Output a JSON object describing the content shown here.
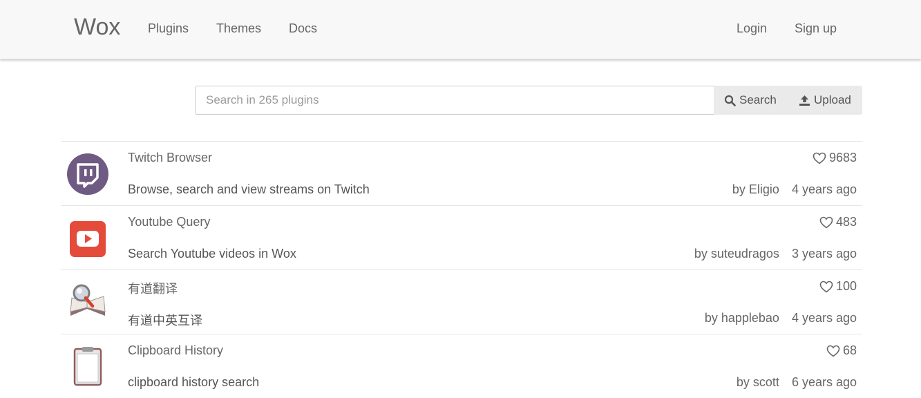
{
  "nav": {
    "brand": "Wox",
    "links": [
      "Plugins",
      "Themes",
      "Docs"
    ],
    "login": "Login",
    "signup": "Sign up"
  },
  "search": {
    "placeholder": "Search in 265 plugins",
    "search_label": "Search",
    "upload_label": "Upload"
  },
  "plugins": [
    {
      "title": "Twitch Browser",
      "description": "Browse, search and view streams on Twitch",
      "likes": "9683",
      "author": "by Eligio",
      "time": "4 years ago",
      "icon": "twitch-icon"
    },
    {
      "title": "Youtube Query",
      "description": "Search Youtube videos in Wox",
      "likes": "483",
      "author": "by suteudragos",
      "time": "3 years ago",
      "icon": "youtube-icon"
    },
    {
      "title": "有道翻译",
      "description": "有道中英互译",
      "likes": "100",
      "author": "by happlebao",
      "time": "4 years ago",
      "icon": "dictionary-magnifier-icon"
    },
    {
      "title": "Clipboard History",
      "description": "clipboard history search",
      "likes": "68",
      "author": "by scott",
      "time": "6 years ago",
      "icon": "clipboard-icon"
    }
  ],
  "colors": {
    "twitch": "#6e5a83",
    "youtube": "#e44b3b"
  }
}
